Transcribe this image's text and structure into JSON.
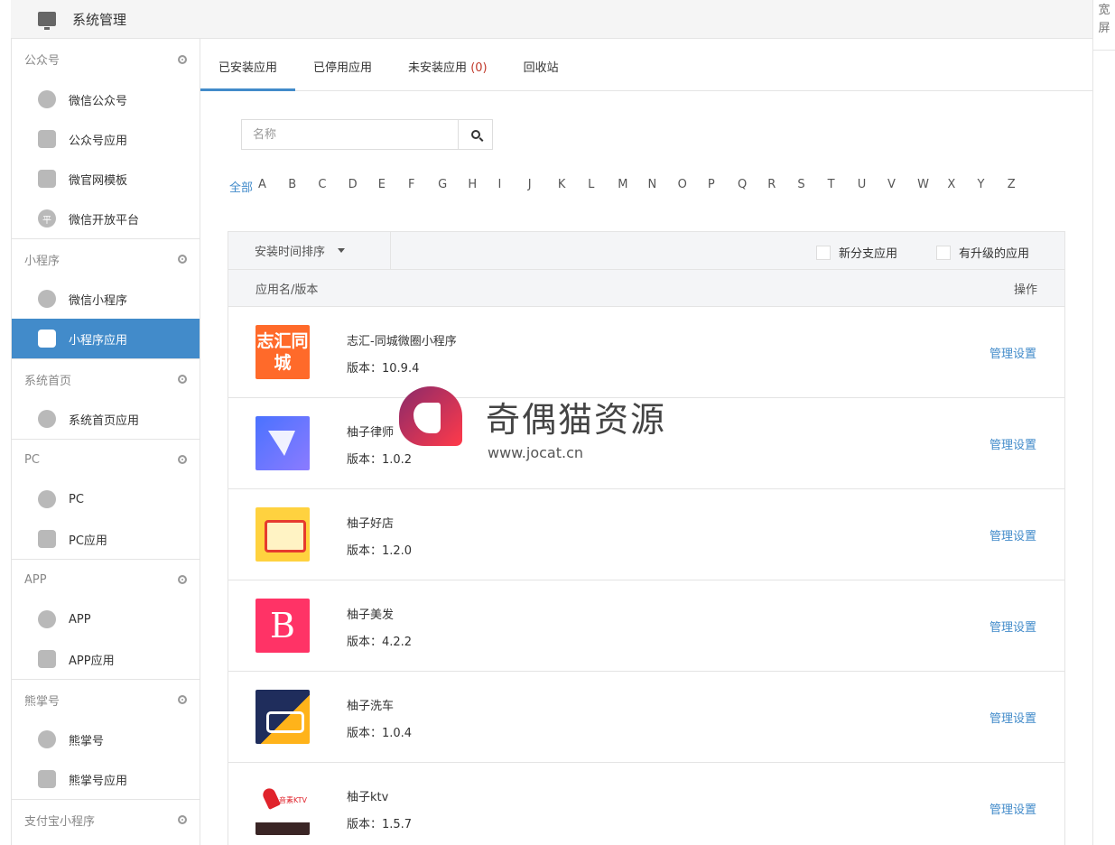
{
  "header": {
    "title": "系统管理"
  },
  "widescreen": {
    "label": "宽屏"
  },
  "sidebar": {
    "sections": [
      {
        "title": "公众号",
        "items": [
          {
            "label": "微信公众号",
            "icon": "wechat-icon"
          },
          {
            "label": "公众号应用",
            "icon": "bag-icon"
          },
          {
            "label": "微官网模板",
            "icon": "wechat-template-icon"
          },
          {
            "label": "微信开放平台",
            "icon": "platform-icon",
            "glyph": "平"
          }
        ]
      },
      {
        "title": "小程序",
        "items": [
          {
            "label": "微信小程序",
            "icon": "miniprogram-icon"
          },
          {
            "label": "小程序应用",
            "icon": "bag-icon",
            "active": true
          }
        ]
      },
      {
        "title": "系统首页",
        "items": [
          {
            "label": "系统首页应用",
            "icon": "miniprogram-icon"
          }
        ]
      },
      {
        "title": "PC",
        "items": [
          {
            "label": "PC",
            "icon": "monitor-icon"
          },
          {
            "label": "PC应用",
            "icon": "bag-icon"
          }
        ]
      },
      {
        "title": "APP",
        "items": [
          {
            "label": "APP",
            "icon": "phone-icon"
          },
          {
            "label": "APP应用",
            "icon": "bag-icon"
          }
        ]
      },
      {
        "title": "熊掌号",
        "items": [
          {
            "label": "熊掌号",
            "icon": "paw-icon"
          },
          {
            "label": "熊掌号应用",
            "icon": "bag-icon"
          }
        ]
      },
      {
        "title": "支付宝小程序",
        "items": []
      }
    ]
  },
  "tabs": [
    {
      "label": "已安装应用",
      "active": true
    },
    {
      "label": "已停用应用"
    },
    {
      "label": "未安装应用",
      "count": "(0)"
    },
    {
      "label": "回收站"
    }
  ],
  "search": {
    "placeholder": "名称"
  },
  "letters": {
    "all": "全部",
    "items": [
      "A",
      "B",
      "C",
      "D",
      "E",
      "F",
      "G",
      "H",
      "I",
      "J",
      "K",
      "L",
      "M",
      "N",
      "O",
      "P",
      "Q",
      "R",
      "S",
      "T",
      "U",
      "V",
      "W",
      "X",
      "Y",
      "Z"
    ]
  },
  "filters": {
    "sort_label": "安装时间排序",
    "new_branch": "新分支应用",
    "upgradable": "有升级的应用"
  },
  "columns": {
    "name": "应用名/版本",
    "action": "操作"
  },
  "apps": [
    {
      "name": "志汇-同城微圈小程序",
      "version": "版本：10.9.4",
      "logo_text": "志汇同城",
      "action": "管理设置"
    },
    {
      "name": "柚子律师",
      "version": "版本：1.0.2",
      "action": "管理设置"
    },
    {
      "name": "柚子好店",
      "version": "版本：1.2.0",
      "action": "管理设置"
    },
    {
      "name": "柚子美发",
      "version": "版本：4.2.2",
      "logo_text": "B",
      "action": "管理设置"
    },
    {
      "name": "柚子洗车",
      "version": "版本：1.0.4",
      "action": "管理设置"
    },
    {
      "name": "柚子ktv",
      "version": "版本：1.5.7",
      "logo_text": "音素KTV",
      "action": "管理设置"
    }
  ],
  "watermark": {
    "title": "奇偶猫资源",
    "url": "www.jocat.cn"
  },
  "colors": {
    "accent": "#428bca",
    "count": "#c0392b"
  }
}
